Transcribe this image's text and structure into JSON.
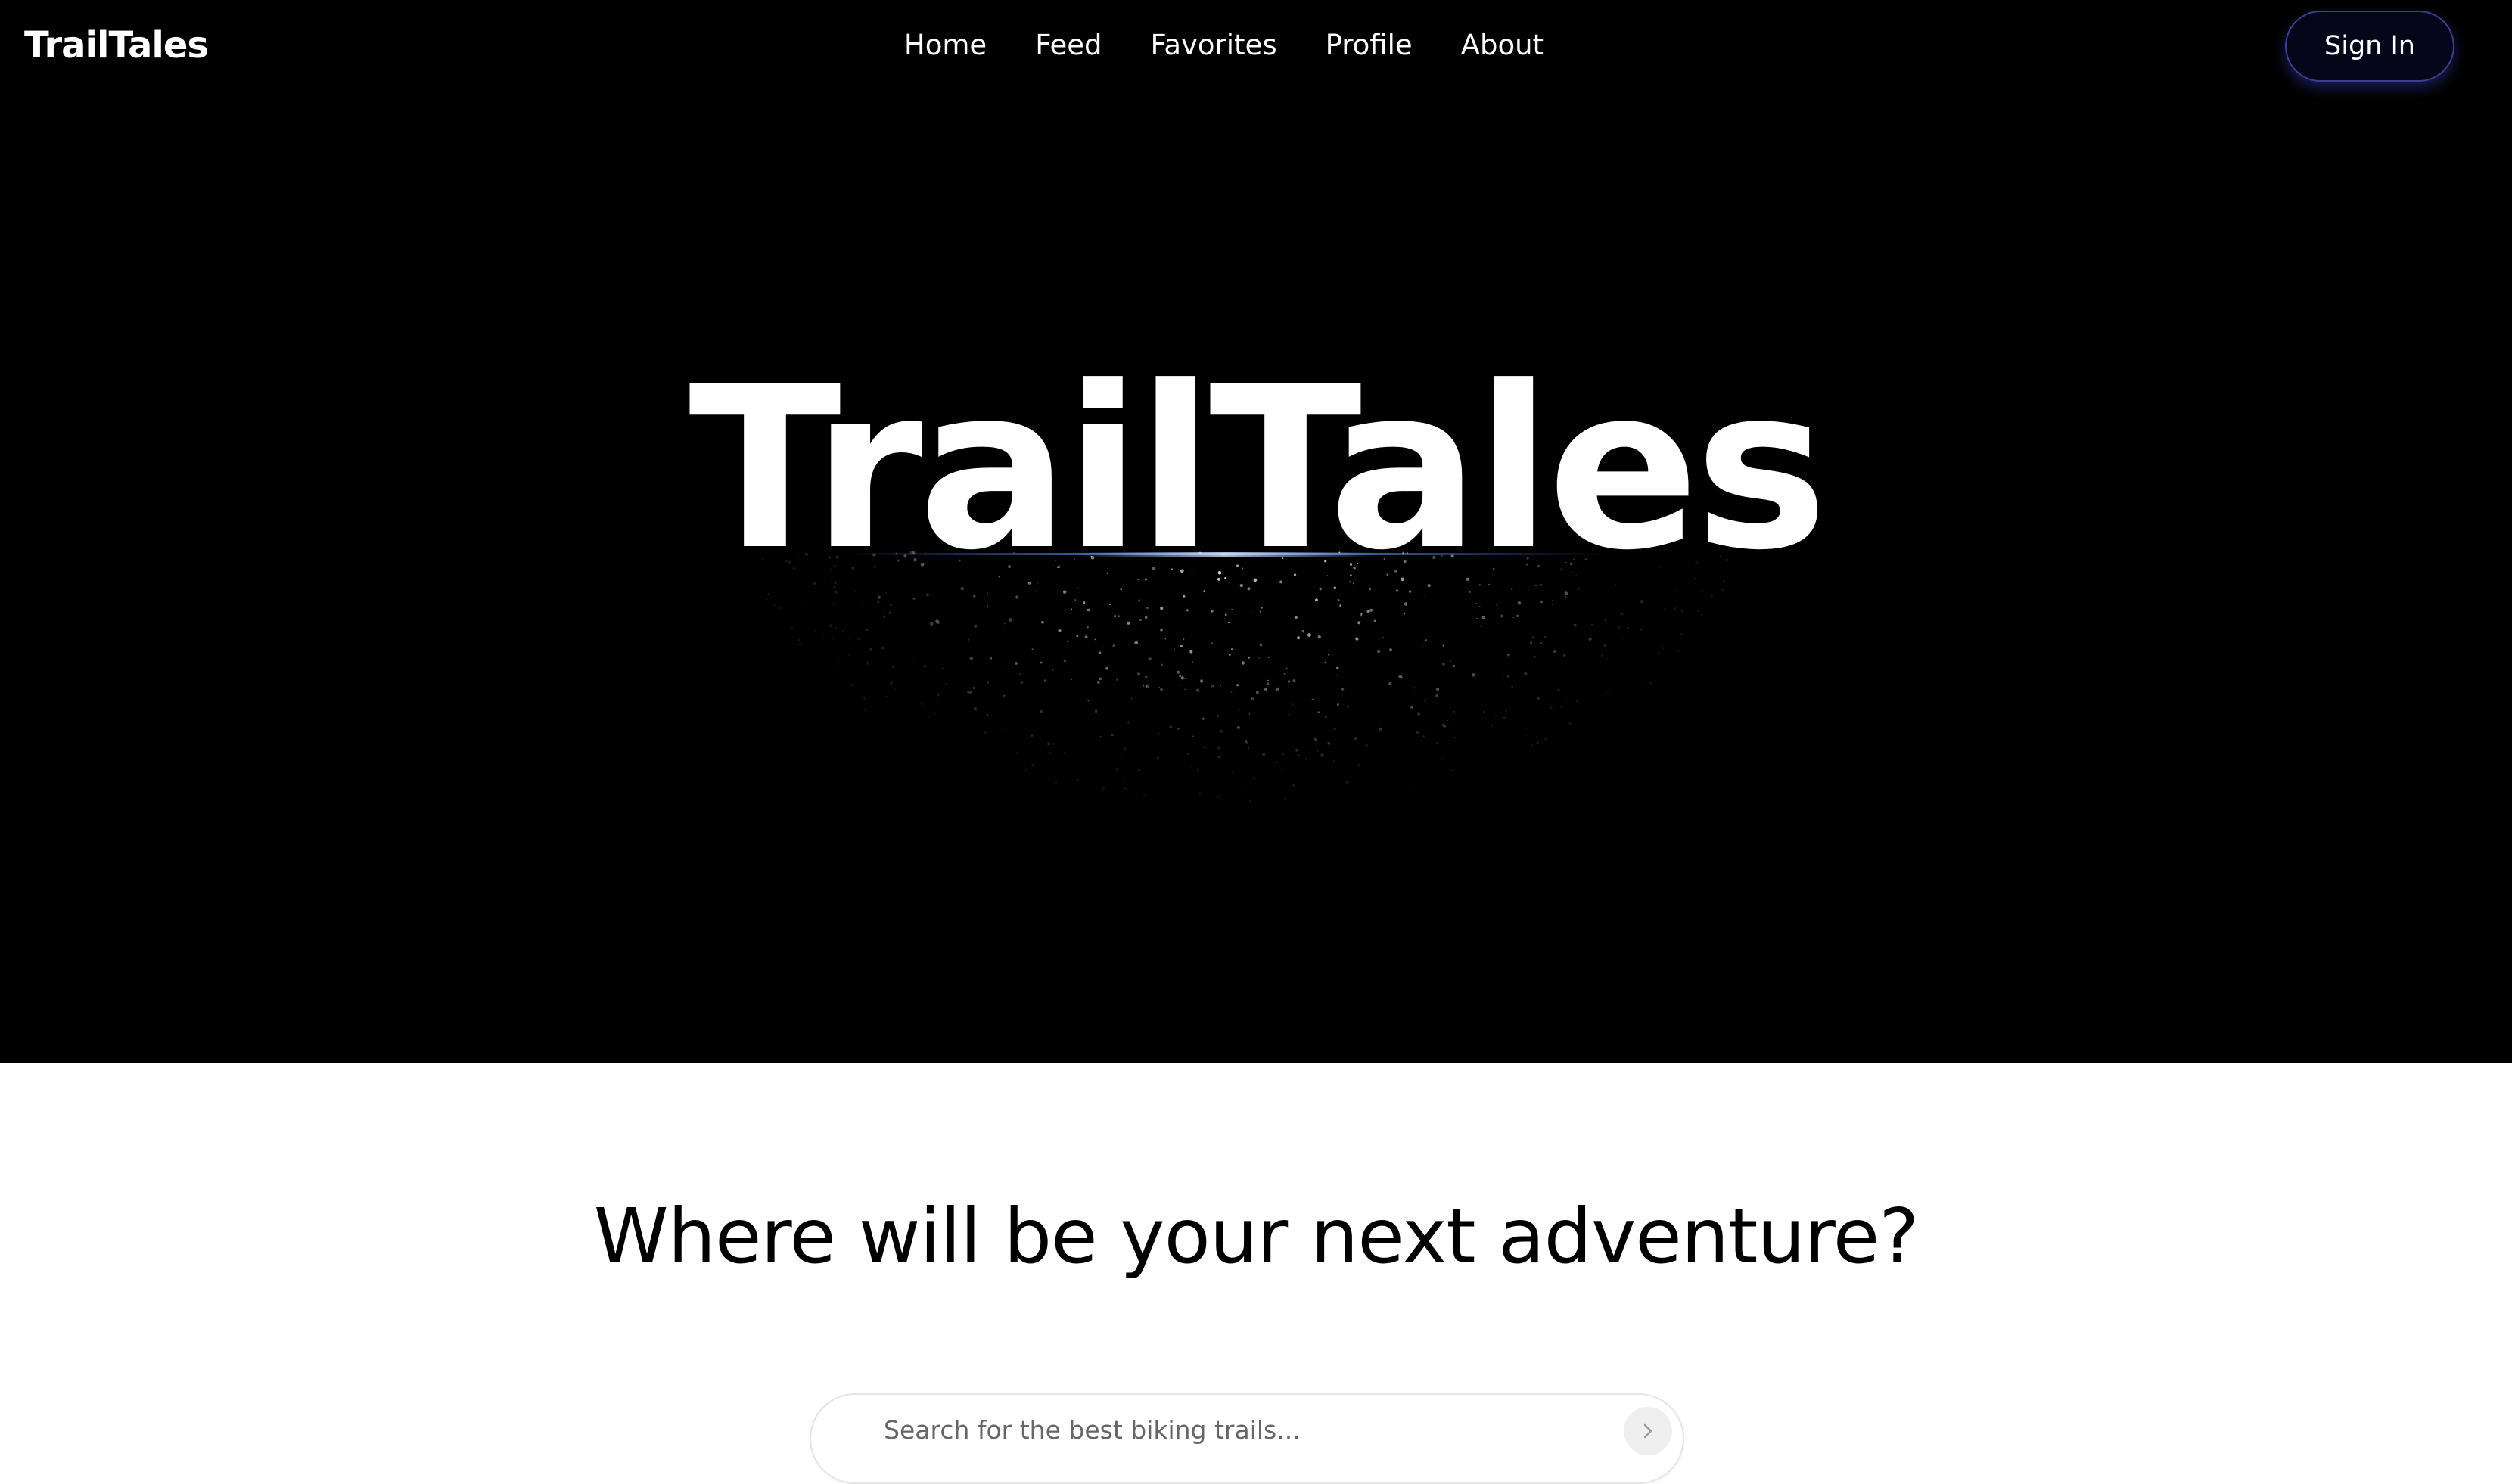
{
  "header": {
    "brand": "TrailTales",
    "nav": [
      {
        "label": "Home"
      },
      {
        "label": "Feed"
      },
      {
        "label": "Favorites"
      },
      {
        "label": "Profile"
      },
      {
        "label": "About"
      }
    ],
    "signin_label": "Sign In"
  },
  "hero": {
    "title": "TrailTales"
  },
  "main": {
    "headline": "Where will be your next adventure?",
    "search": {
      "placeholder": "Search for the best biking trails...",
      "value": "",
      "button_icon": "chevron-right-icon"
    }
  },
  "colors": {
    "hero_bg": "#000000",
    "accent_glow": "#4a7dff",
    "signin_border": "#3b3f8c"
  }
}
